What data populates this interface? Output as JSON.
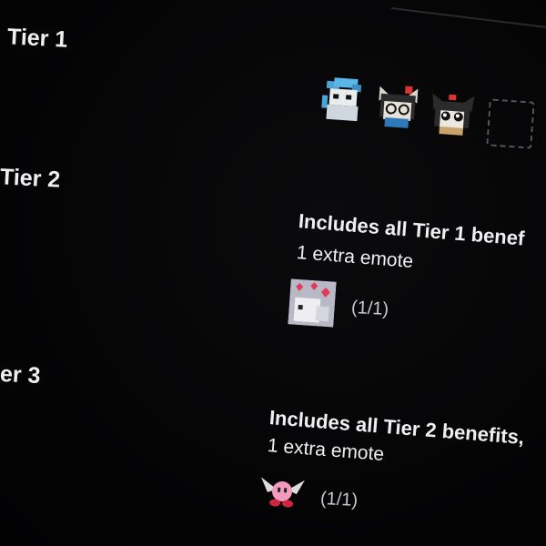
{
  "tiers": [
    {
      "label": "Tier 1",
      "emotes": [
        {
          "icon": "blue-hair-emote-icon"
        },
        {
          "icon": "dizzy-cat-emote-icon"
        },
        {
          "icon": "cat-face-emote-icon"
        }
      ],
      "empty_slots": 1
    },
    {
      "label": "Tier 2",
      "benefits_title": "Includes all Tier 1 benef",
      "benefits_sub": "1 extra emote",
      "emote_icon": "heart-ghost-emote-icon",
      "count": "(1/1)"
    },
    {
      "label": "er 3",
      "benefits_title": "Includes all Tier 2 benefits,",
      "benefits_sub": "1 extra emote",
      "emote_icon": "winged-pink-emote-icon",
      "count": "(1/1)"
    }
  ],
  "colors": {
    "background": "#000000",
    "text": "#efeff1",
    "muted": "#c8c8cc"
  }
}
